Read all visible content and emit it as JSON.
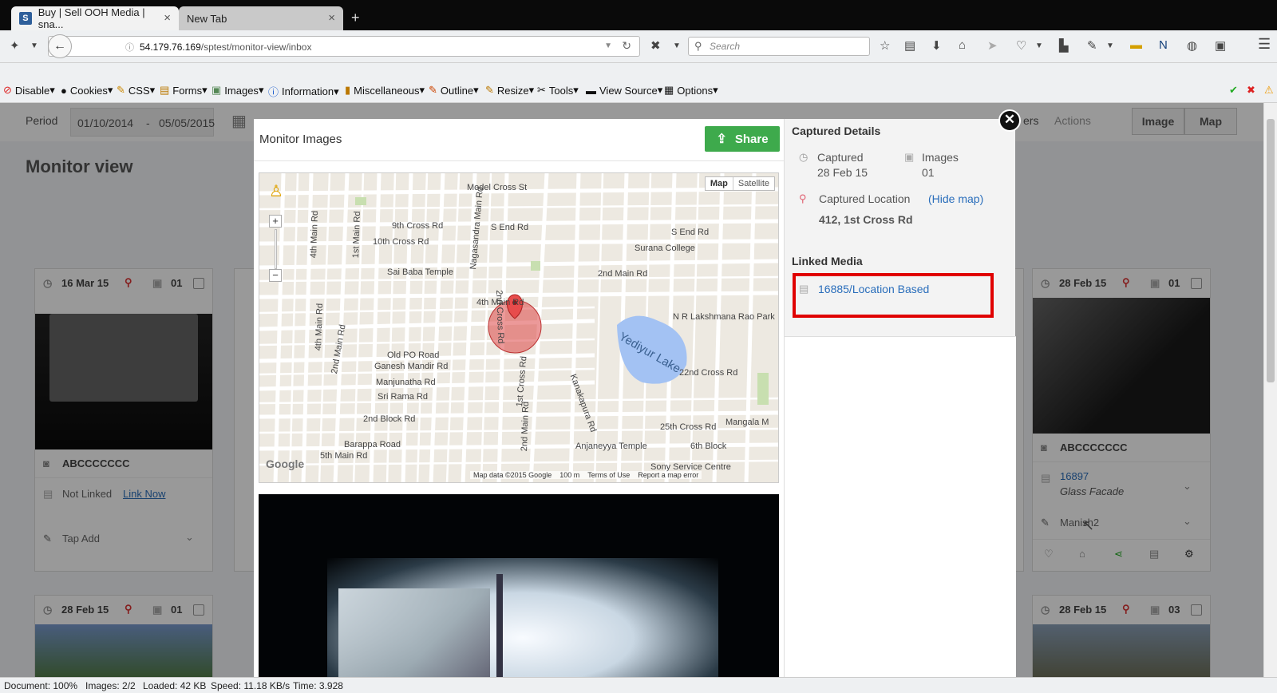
{
  "browser": {
    "tabs": [
      {
        "title": "Buy | Sell OOH Media | sna...",
        "close": "×"
      },
      {
        "title": "New Tab",
        "close": "×"
      }
    ],
    "new_tab": "+",
    "url_domain": "54.179.76.169",
    "url_path": "/sptest/monitor-view/inbox",
    "search_placeholder": "Search",
    "back_icon": "←"
  },
  "webdev_toolbar": {
    "items": [
      "Disable",
      "Cookies",
      "CSS",
      "Forms",
      "Images",
      "Information",
      "Miscellaneous",
      "Outline",
      "Resize",
      "Tools",
      "View Source",
      "Options"
    ]
  },
  "page": {
    "period_label": "Period",
    "period_from": "01/10/2014",
    "period_sep": "-",
    "period_to": "05/05/2015",
    "filters_label": "ers",
    "actions_label": "Actions",
    "view_image": "Image",
    "view_map": "Map",
    "title": "Monitor view",
    "cards": [
      {
        "date": "16 Mar 15",
        "count": "01",
        "name": "ABCCCCCCC",
        "link_status": "Not Linked",
        "link_action": "Link Now",
        "tap": "Tap Add"
      },
      {
        "date": "28 Feb 15",
        "count": "01",
        "name": "ABCCCCCCC",
        "media_id": "16897",
        "media_type": "Glass Facade",
        "user": "Manish2"
      }
    ],
    "lower_cards": [
      {
        "date": "28 Feb 15",
        "count": "01"
      },
      {
        "date": "28 Feb 15",
        "count": "03"
      }
    ]
  },
  "modal": {
    "title": "Monitor Images",
    "share_label": "Share",
    "close_icon": "✕",
    "map": {
      "type_map": "Map",
      "type_satellite": "Satellite",
      "lake": "Yediyur Lake",
      "streets": [
        "Model Cross St",
        "9th Cross Rd",
        "S End Rd",
        "S End Rd",
        "10th Cross Rd",
        "Surana College",
        "Sai Baba Temple",
        "2nd Main Rd",
        "4th Main Rd",
        "N R Lakshmana Rao Park",
        "Old PO Road",
        "Ganesh Mandir Rd",
        "Manjunatha Rd",
        "Sri Rama Rd",
        "2nd Block Rd",
        "Barappa Road",
        "5th Main Rd",
        "22nd Cross Rd",
        "25th Cross Rd",
        "Anjaneyya Temple",
        "6th Block",
        "Mangala M",
        "Sony Service Centre",
        "Kanakapura Rd",
        "Nagasandra Main Rd",
        "1st Cross Rd",
        "2nd Main Rd",
        "4th Main Rd",
        "1st Main Rd",
        "2nd Main Rd",
        "4th Main Rd",
        "2nd Cross Rd"
      ],
      "zoom_in": "+",
      "zoom_out": "−",
      "footer_data": "Map data ©2015 Google",
      "footer_scale": "100 m",
      "footer_terms": "Terms of Use",
      "footer_report": "Report a map error",
      "google": "Google"
    },
    "details": {
      "heading": "Captured Details",
      "captured_label": "Captured",
      "captured_value": "28 Feb 15",
      "images_label": "Images",
      "images_value": "01",
      "location_label": "Captured Location",
      "hide_map": "(Hide map)",
      "location_value": "412, 1st Cross Rd",
      "linked_heading": "Linked Media",
      "linked_item": "16885/Location Based"
    }
  },
  "statusbar": {
    "document": "Document: 100%",
    "images": "Images: 2/2",
    "loaded": "Loaded: 42 KB",
    "speed": "Speed: 11.18 KB/s",
    "time": "Time: 3.928"
  },
  "colors": {
    "share_green": "#3eaa4c",
    "highlight_red": "#e00000",
    "link_blue": "#2a6ebb"
  }
}
